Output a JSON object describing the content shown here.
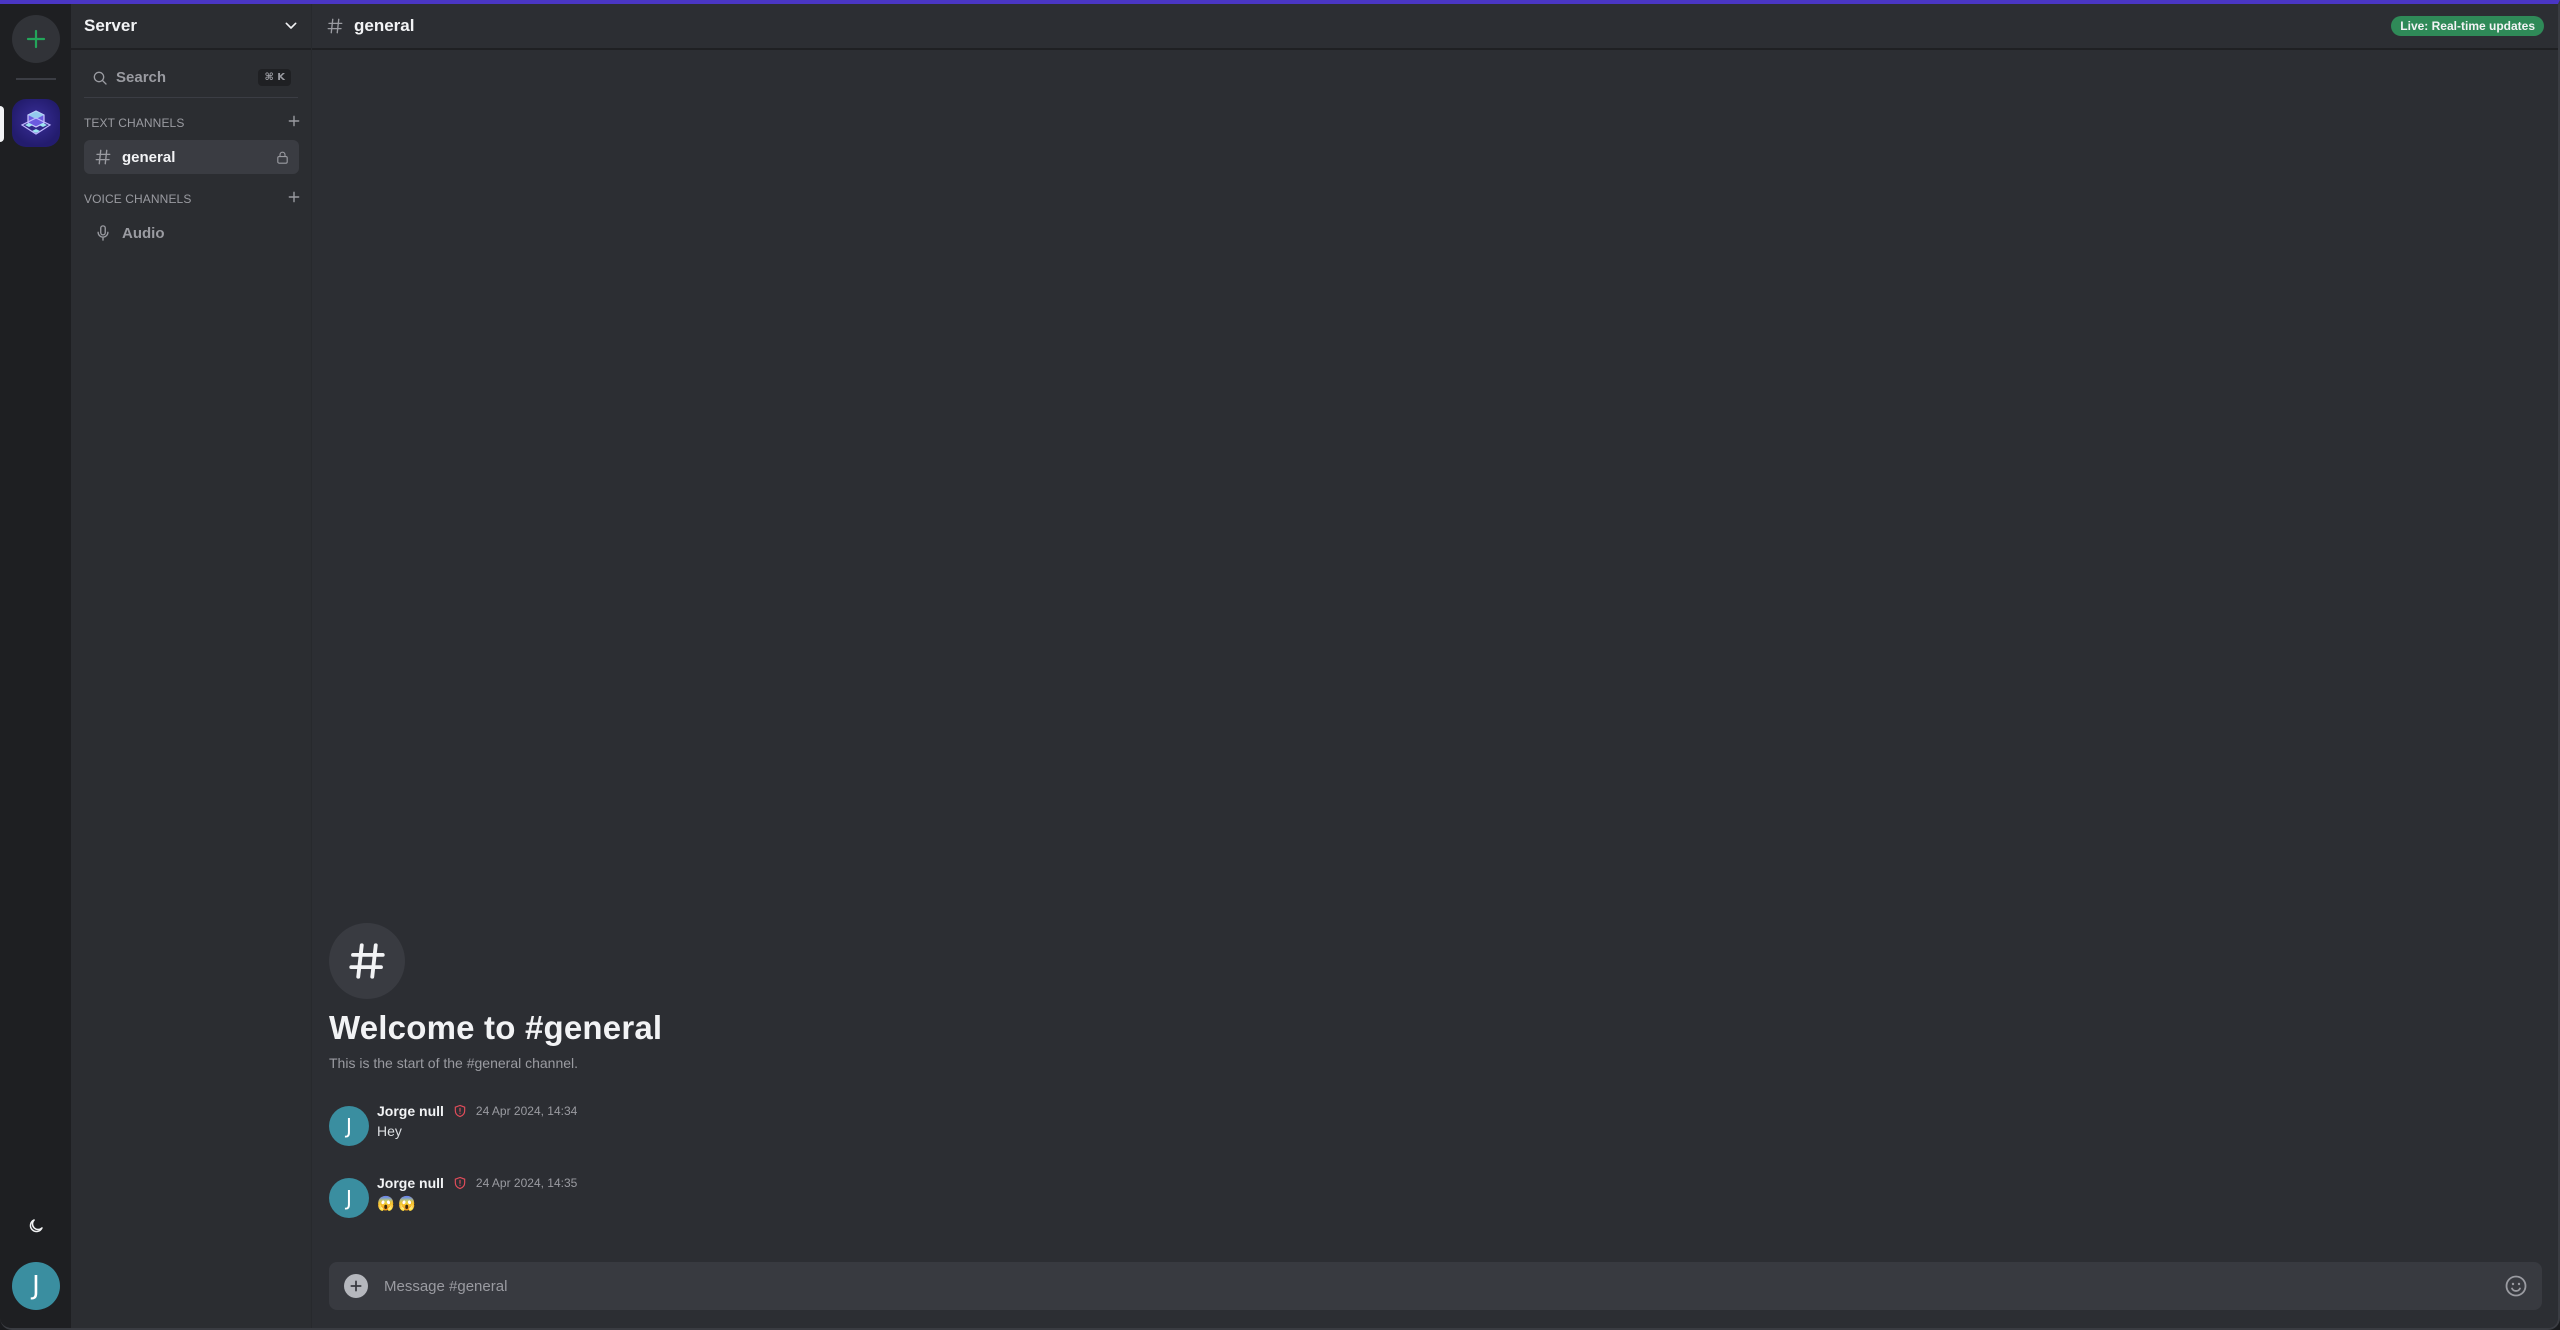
{
  "rail": {
    "add_server_label": "+",
    "user_initial": "J",
    "theme_icon": "moon-icon"
  },
  "sidebar": {
    "server_name": "Server",
    "search_label": "Search",
    "search_shortcut": "⌘ K",
    "categories": [
      {
        "label": "TEXT CHANNELS",
        "channels": [
          {
            "name": "general",
            "type": "text",
            "active": true,
            "locked": true
          }
        ]
      },
      {
        "label": "VOICE CHANNELS",
        "channels": [
          {
            "name": "Audio",
            "type": "voice",
            "active": false,
            "locked": false
          }
        ]
      }
    ]
  },
  "header": {
    "channel_name": "general",
    "live_badge": "Live: Real-time updates"
  },
  "welcome": {
    "title": "Welcome to #general",
    "subtitle": "This is the start of the #general channel."
  },
  "messages": [
    {
      "author": "Jorge null",
      "initial": "J",
      "timestamp": "24 Apr 2024, 14:34",
      "text": "Hey"
    },
    {
      "author": "Jorge null",
      "initial": "J",
      "timestamp": "24 Apr 2024, 14:35",
      "text": "😱 😱"
    }
  ],
  "composer": {
    "placeholder": "Message #general",
    "value": ""
  },
  "colors": {
    "accent_top": "#4a36c4",
    "add_server": "#23a55a",
    "live_badge": "#2f8a58",
    "avatar": "#3a8ea0",
    "admin_shield": "#e04c5a"
  }
}
